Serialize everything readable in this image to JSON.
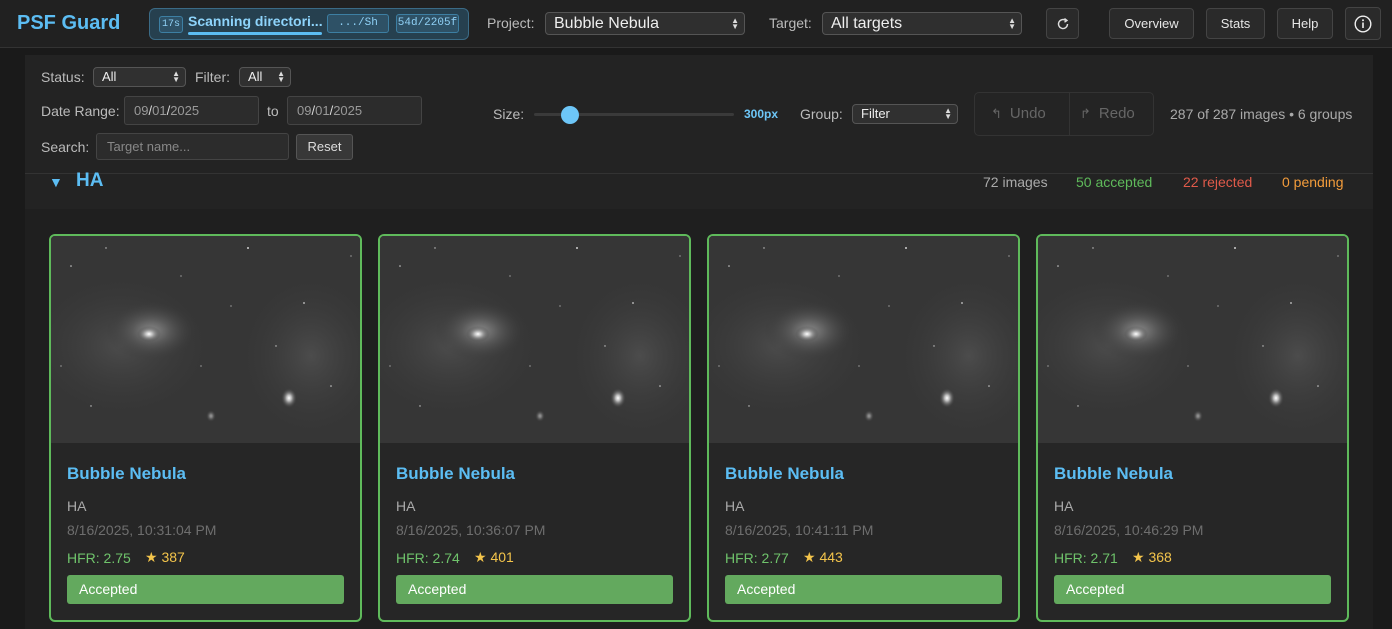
{
  "header": {
    "brand": "PSF Guard",
    "scan": {
      "elapsed": "17s",
      "text": "Scanning directori...",
      "path": ".../Sh",
      "count": "54d/2205f"
    },
    "project_label": "Project:",
    "project_value": "Bubble Nebula",
    "target_label": "Target:",
    "target_value": "All targets",
    "refresh_icon": "refresh-icon",
    "buttons": {
      "overview": "Overview",
      "stats": "Stats",
      "help": "Help"
    },
    "info_icon": "info-icon"
  },
  "controls": {
    "status_label": "Status:",
    "status_value": "All",
    "filter_label": "Filter:",
    "filter_value": "All",
    "date_range_label": "Date Range:",
    "date_from": {
      "mm": "09",
      "dd": "01",
      "yyyy": "2025"
    },
    "date_to_label": "to",
    "date_to": {
      "mm": "09",
      "dd": "01",
      "yyyy": "2025"
    },
    "search_label": "Search:",
    "search_placeholder": "Target name...",
    "reset_label": "Reset",
    "size_label": "Size:",
    "size_value": "300px",
    "group_label": "Group:",
    "group_value": "Filter",
    "undo_label": "Undo",
    "redo_label": "Redo",
    "summary": "287 of 287 images • 6 groups"
  },
  "group": {
    "name": "HA",
    "images": "72 images",
    "accepted": "50 accepted",
    "rejected": "22 rejected",
    "pending": "0 pending"
  },
  "colors": {
    "accent": "#5cbdf3",
    "accepted": "#5fba5b",
    "rejected": "#e05a4a",
    "pending": "#f39c3b"
  },
  "cards": [
    {
      "title": "Bubble Nebula",
      "filter": "HA",
      "date": "8/16/2025, 10:31:04 PM",
      "hfr": "HFR: 2.75",
      "stars": "387",
      "status": "Accepted"
    },
    {
      "title": "Bubble Nebula",
      "filter": "HA",
      "date": "8/16/2025, 10:36:07 PM",
      "hfr": "HFR: 2.74",
      "stars": "401",
      "status": "Accepted"
    },
    {
      "title": "Bubble Nebula",
      "filter": "HA",
      "date": "8/16/2025, 10:41:11 PM",
      "hfr": "HFR: 2.77",
      "stars": "443",
      "status": "Accepted"
    },
    {
      "title": "Bubble Nebula",
      "filter": "HA",
      "date": "8/16/2025, 10:46:29 PM",
      "hfr": "HFR: 2.71",
      "stars": "368",
      "status": "Accepted"
    }
  ]
}
